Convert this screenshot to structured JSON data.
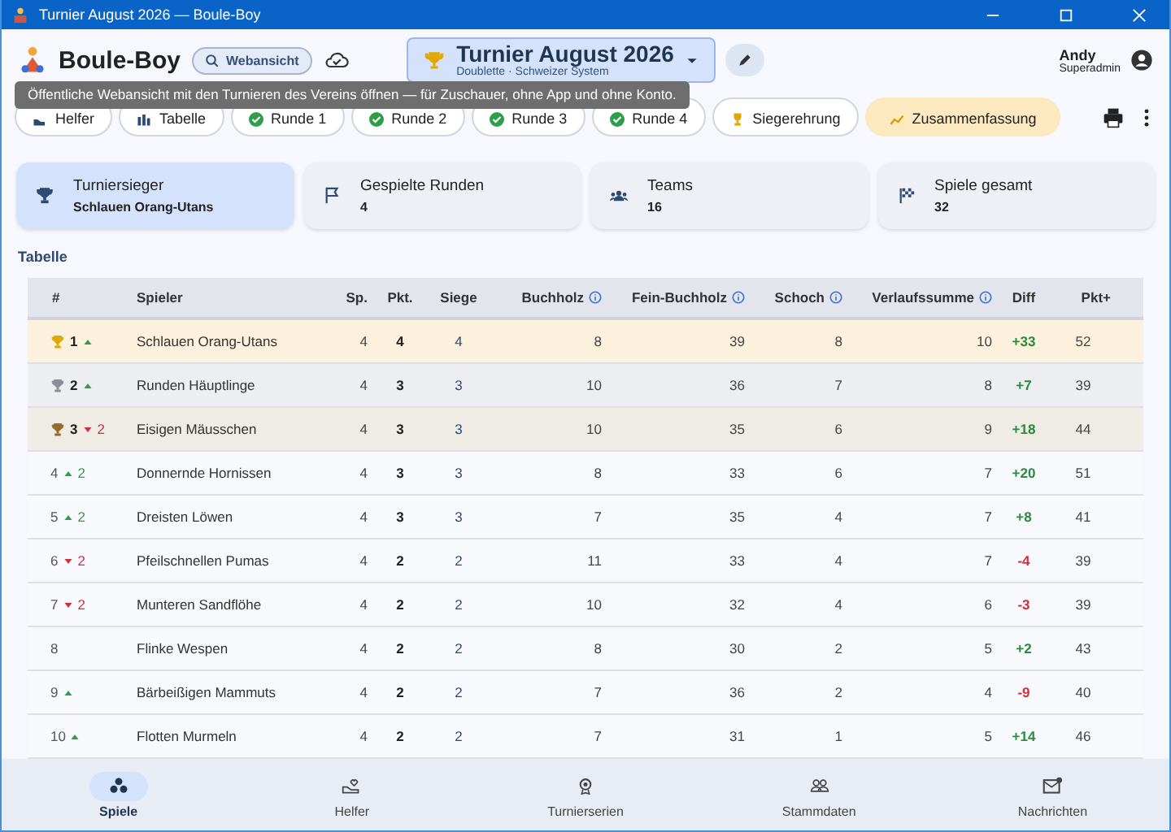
{
  "window": {
    "title": "Turnier August 2026 — Boule-Boy"
  },
  "app": {
    "name": "Boule-Boy",
    "web_button": "Webansicht"
  },
  "tournament": {
    "title": "Turnier August 2026",
    "subtitle": "Doublette · Schweizer System"
  },
  "user": {
    "name": "Andy",
    "role": "Superadmin"
  },
  "tooltip": "Öffentliche Webansicht mit den Turnieren des Vereins öffnen — für Zuschauer, ohne App und ohne Konto.",
  "tabs": [
    {
      "label": "Helfer",
      "kind": "helper",
      "selected": false
    },
    {
      "label": "Tabelle",
      "kind": "table",
      "selected": false
    },
    {
      "label": "Runde 1",
      "kind": "done",
      "selected": false
    },
    {
      "label": "Runde 2",
      "kind": "done",
      "selected": false
    },
    {
      "label": "Runde 3",
      "kind": "done",
      "selected": false
    },
    {
      "label": "Runde 4",
      "kind": "done",
      "selected": false
    },
    {
      "label": "Siegerehrung",
      "kind": "trophy",
      "selected": false
    },
    {
      "label": "Zusammenfassung",
      "kind": "summary",
      "selected": true
    }
  ],
  "stats": [
    {
      "label": "Turniersieger",
      "value": "Schlauen Orang-Utans",
      "kind": "trophy",
      "selected": true
    },
    {
      "label": "Gespielte Runden",
      "value": "4",
      "kind": "flag",
      "selected": false
    },
    {
      "label": "Teams",
      "value": "16",
      "kind": "teams",
      "selected": false
    },
    {
      "label": "Spiele gesamt",
      "value": "32",
      "kind": "finish",
      "selected": false
    }
  ],
  "table": {
    "title": "Tabelle",
    "columns": [
      {
        "label": "#",
        "info": false
      },
      {
        "label": "Spieler",
        "info": false
      },
      {
        "label": "Sp.",
        "info": false
      },
      {
        "label": "Pkt.",
        "info": false
      },
      {
        "label": "Siege",
        "info": false
      },
      {
        "label": "Buchholz",
        "info": true
      },
      {
        "label": "Fein-Buchholz",
        "info": true
      },
      {
        "label": "Schoch",
        "info": true
      },
      {
        "label": "Verlaufssumme",
        "info": true
      },
      {
        "label": "Diff",
        "info": false
      },
      {
        "label": "Pkt+",
        "info": false
      }
    ],
    "rows": [
      {
        "rank": "1",
        "color": "#e0a800",
        "trend_up": true,
        "trend_down": false,
        "trend_count": "",
        "name": "Schlauen Orang-Utans",
        "sp": "4",
        "pkt": "4",
        "siege": "4",
        "buchholz": "8",
        "fein": "39",
        "schoch": "8",
        "verlauf": "10",
        "diff": "+33",
        "negative": false,
        "pkt_plus": "52"
      },
      {
        "rank": "2",
        "color": "#8a8f96",
        "trend_up": true,
        "trend_down": false,
        "trend_count": "",
        "name": "Runden Häuptlinge",
        "sp": "4",
        "pkt": "3",
        "siege": "3",
        "buchholz": "10",
        "fein": "36",
        "schoch": "7",
        "verlauf": "8",
        "diff": "+7",
        "negative": false,
        "pkt_plus": "39"
      },
      {
        "rank": "3",
        "color": "#9a6a2a",
        "trend_up": false,
        "trend_down": true,
        "trend_count": "2",
        "name": "Eisigen Mäusschen",
        "sp": "4",
        "pkt": "3",
        "siege": "3",
        "buchholz": "10",
        "fein": "35",
        "schoch": "6",
        "verlauf": "9",
        "diff": "+18",
        "negative": false,
        "pkt_plus": "44"
      },
      {
        "rank": "4",
        "trend_up": true,
        "trend_down": false,
        "trend_count": "2",
        "name": "Donnernde Hornissen",
        "sp": "4",
        "pkt": "3",
        "siege": "3",
        "buchholz": "8",
        "fein": "33",
        "schoch": "6",
        "verlauf": "7",
        "diff": "+20",
        "negative": false,
        "pkt_plus": "51"
      },
      {
        "rank": "5",
        "trend_up": true,
        "trend_down": false,
        "trend_count": "2",
        "name": "Dreisten Löwen",
        "sp": "4",
        "pkt": "3",
        "siege": "3",
        "buchholz": "7",
        "fein": "35",
        "schoch": "4",
        "verlauf": "7",
        "diff": "+8",
        "negative": false,
        "pkt_plus": "41"
      },
      {
        "rank": "6",
        "trend_up": false,
        "trend_down": true,
        "trend_count": "2",
        "name": "Pfeilschnellen Pumas",
        "sp": "4",
        "pkt": "2",
        "siege": "2",
        "buchholz": "11",
        "fein": "33",
        "schoch": "4",
        "verlauf": "7",
        "diff": "-4",
        "negative": true,
        "pkt_plus": "39"
      },
      {
        "rank": "7",
        "trend_up": false,
        "trend_down": true,
        "trend_count": "2",
        "name": "Munteren Sandflöhe",
        "sp": "4",
        "pkt": "2",
        "siege": "2",
        "buchholz": "10",
        "fein": "32",
        "schoch": "4",
        "verlauf": "6",
        "diff": "-3",
        "negative": true,
        "pkt_plus": "39"
      },
      {
        "rank": "8",
        "trend_up": false,
        "trend_down": false,
        "trend_count": "",
        "name": "Flinke Wespen",
        "sp": "4",
        "pkt": "2",
        "siege": "2",
        "buchholz": "8",
        "fein": "30",
        "schoch": "2",
        "verlauf": "5",
        "diff": "+2",
        "negative": false,
        "pkt_plus": "43"
      },
      {
        "rank": "9",
        "trend_up": true,
        "trend_down": false,
        "trend_count": "",
        "name": "Bärbeißigen Mammuts",
        "sp": "4",
        "pkt": "2",
        "siege": "2",
        "buchholz": "7",
        "fein": "36",
        "schoch": "2",
        "verlauf": "4",
        "diff": "-9",
        "negative": true,
        "pkt_plus": "40"
      },
      {
        "rank": "10",
        "trend_up": true,
        "trend_down": false,
        "trend_count": "",
        "name": "Flotten Murmeln",
        "sp": "4",
        "pkt": "2",
        "siege": "2",
        "buchholz": "7",
        "fein": "31",
        "schoch": "1",
        "verlauf": "5",
        "diff": "+14",
        "negative": false,
        "pkt_plus": "46"
      }
    ]
  },
  "nav": [
    {
      "label": "Spiele",
      "kind": "games",
      "selected": true
    },
    {
      "label": "Helfer",
      "kind": "helper",
      "selected": false
    },
    {
      "label": "Turnierserien",
      "kind": "series",
      "selected": false
    },
    {
      "label": "Stammdaten",
      "kind": "people",
      "selected": false
    },
    {
      "label": "Nachrichten",
      "kind": "mail",
      "selected": false
    }
  ]
}
